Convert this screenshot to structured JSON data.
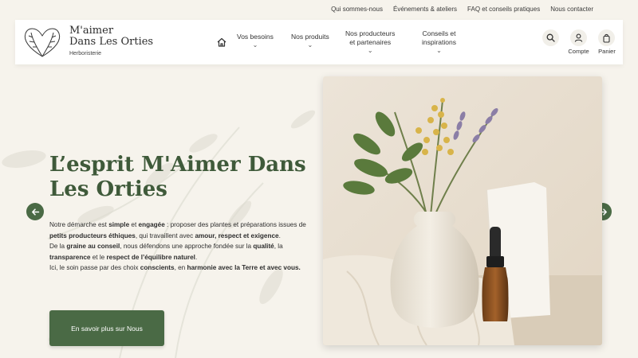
{
  "topbar": {
    "links": [
      "Qui sommes-nous",
      "Événements & ateliers",
      "FAQ et conseils pratiques",
      "Nous contacter"
    ]
  },
  "header": {
    "brand_line1": "M'aimer",
    "brand_line2": "Dans Les Orties",
    "tagline": "Herboristerie",
    "nav": [
      {
        "line1": "Vos besoins",
        "line2": ""
      },
      {
        "line1": "Nos produits",
        "line2": ""
      },
      {
        "line1": "Nos producteurs",
        "line2": "et partenaires"
      },
      {
        "line1": "Conseils et",
        "line2": "inspirations"
      }
    ],
    "account_label": "Compte",
    "cart_label": "Panier",
    "icons": {
      "home": "home-icon",
      "search": "search-icon",
      "account": "user-icon",
      "cart": "bag-icon",
      "nav_chevron": "chevron-down-icon"
    }
  },
  "hero": {
    "title": "L’esprit M'Aimer Dans Les Orties",
    "paragraph": [
      {
        "t": "Notre démarche est ",
        "b": false
      },
      {
        "t": "simple",
        "b": true
      },
      {
        "t": " et ",
        "b": false
      },
      {
        "t": "engagée",
        "b": true
      },
      {
        "t": " : proposer des plantes et préparations issues de ",
        "b": false
      },
      {
        "t": "petits producteurs éthiques",
        "b": true
      },
      {
        "t": ", qui travaillent avec ",
        "b": false
      },
      {
        "t": "amour, respect et exigence",
        "b": true
      },
      {
        "t": ".",
        "b": false
      },
      {
        "br": true
      },
      {
        "t": "De la ",
        "b": false
      },
      {
        "t": "graine au conseil",
        "b": true
      },
      {
        "t": ", nous défendons une approche fondée sur la ",
        "b": false
      },
      {
        "t": "qualité",
        "b": true
      },
      {
        "t": ", la ",
        "b": false
      },
      {
        "t": "transparence",
        "b": true
      },
      {
        "t": " et le ",
        "b": false
      },
      {
        "t": "respect de l’équilibre naturel",
        "b": true
      },
      {
        "t": ".",
        "b": false
      },
      {
        "br": true
      },
      {
        "t": "Ici, le soin passe par des choix ",
        "b": false
      },
      {
        "t": "conscients",
        "b": true
      },
      {
        "t": ", en ",
        "b": false
      },
      {
        "t": "harmonie avec la Terre et avec vous.",
        "b": true
      }
    ],
    "cta_label": "En savoir plus sur Nous",
    "prev_icon": "arrow-left-icon",
    "next_icon": "arrow-right-icon"
  },
  "colors": {
    "accent_green": "#4a6a45",
    "title_green": "#3f5a3a",
    "background": "#f6f3ec"
  }
}
